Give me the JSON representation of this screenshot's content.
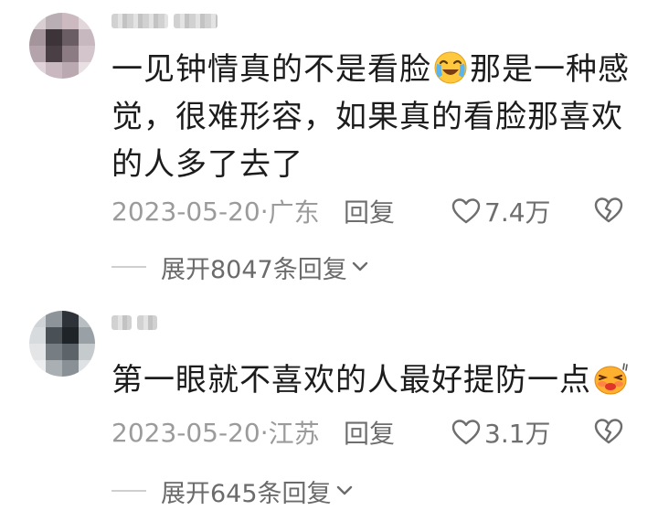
{
  "comments": [
    {
      "username": "盖 色",
      "text_before": "一见钟情真的不是看脸",
      "emoji": "cry-laugh-emoji",
      "text_after": "那是一种感觉，很难形容，如果真的看脸那喜欢的人多了去了",
      "date": "2023-05-20",
      "location": "广东",
      "reply_label": "回复",
      "likes": "7.4万",
      "expand_label": "展开8047条回复"
    },
    {
      "username": "",
      "text_before": "第一眼就不喜欢的人最好提防一点",
      "emoji": "sweat-blush-emoji",
      "text_after": "",
      "date": "2023-05-20",
      "location": "江苏",
      "reply_label": "回复",
      "likes": "3.1万",
      "expand_label": "展开645条回复"
    }
  ],
  "separator": " · ",
  "icons": {
    "like": "heart-outline-icon",
    "dislike": "broken-heart-icon",
    "expand": "chevron-down-icon"
  },
  "colors": {
    "text": "#1c1c1c",
    "meta": "#9b9b9b",
    "action": "#6e6e6e"
  }
}
